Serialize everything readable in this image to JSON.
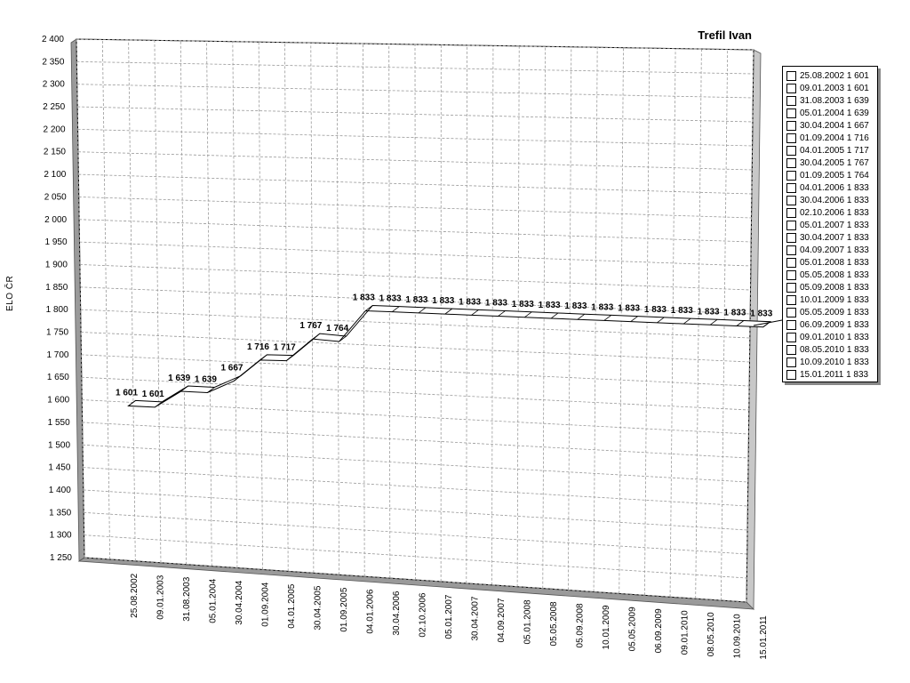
{
  "chart_data": {
    "type": "line",
    "title": "Trefil Ivan",
    "ylabel": "ELO ČR",
    "xlabel": "",
    "ylim": [
      1250,
      2400
    ],
    "yticks": [
      "2 400",
      "2 350",
      "2 300",
      "2 250",
      "2 200",
      "2 150",
      "2 100",
      "2 050",
      "2 000",
      "1 950",
      "1 900",
      "1 850",
      "1 800",
      "1 750",
      "1 700",
      "1 650",
      "1 600",
      "1 550",
      "1 500",
      "1 450",
      "1 400",
      "1 350",
      "1 300",
      "1 250"
    ],
    "grid": true,
    "legend_position": "right",
    "categories": [
      "25.08.2002",
      "09.01.2003",
      "31.08.2003",
      "05.01.2004",
      "30.04.2004",
      "01.09.2004",
      "04.01.2005",
      "30.04.2005",
      "01.09.2005",
      "04.01.2006",
      "30.04.2006",
      "02.10.2006",
      "05.01.2007",
      "30.04.2007",
      "04.09.2007",
      "05.01.2008",
      "05.05.2008",
      "05.09.2008",
      "10.01.2009",
      "05.05.2009",
      "06.09.2009",
      "09.01.2010",
      "08.05.2010",
      "10.09.2010",
      "15.01.2011"
    ],
    "values": [
      1601,
      1601,
      1639,
      1639,
      1667,
      1716,
      1717,
      1767,
      1764,
      1833,
      1833,
      1833,
      1833,
      1833,
      1833,
      1833,
      1833,
      1833,
      1833,
      1833,
      1833,
      1833,
      1833,
      1833,
      1833
    ],
    "data_labels": [
      "1 601",
      "1 601",
      "1 639",
      "1 639",
      "1 667",
      "1 716",
      "1 717",
      "1 767",
      "1 764",
      "1 833",
      "1 833",
      "1 833",
      "1 833",
      "1 833",
      "1 833",
      "1 833",
      "1 833",
      "1 833",
      "1 833",
      "1 833",
      "1 833",
      "1 833",
      "1 833",
      "1 833",
      "1 833"
    ],
    "legend": [
      "25.08.2002 1 601",
      "09.01.2003 1 601",
      "31.08.2003 1 639",
      "05.01.2004 1 639",
      "30.04.2004 1 667",
      "01.09.2004 1 716",
      "04.01.2005 1 717",
      "30.04.2005 1 767",
      "01.09.2005 1 764",
      "04.01.2006 1 833",
      "30.04.2006 1 833",
      "02.10.2006 1 833",
      "05.01.2007 1 833",
      "30.04.2007 1 833",
      "04.09.2007 1 833",
      "05.01.2008 1 833",
      "05.05.2008 1 833",
      "05.09.2008 1 833",
      "10.01.2009 1 833",
      "05.05.2009 1 833",
      "06.09.2009 1 833",
      "09.01.2010 1 833",
      "08.05.2010 1 833",
      "10.09.2010 1 833",
      "15.01.2011 1 833"
    ]
  }
}
